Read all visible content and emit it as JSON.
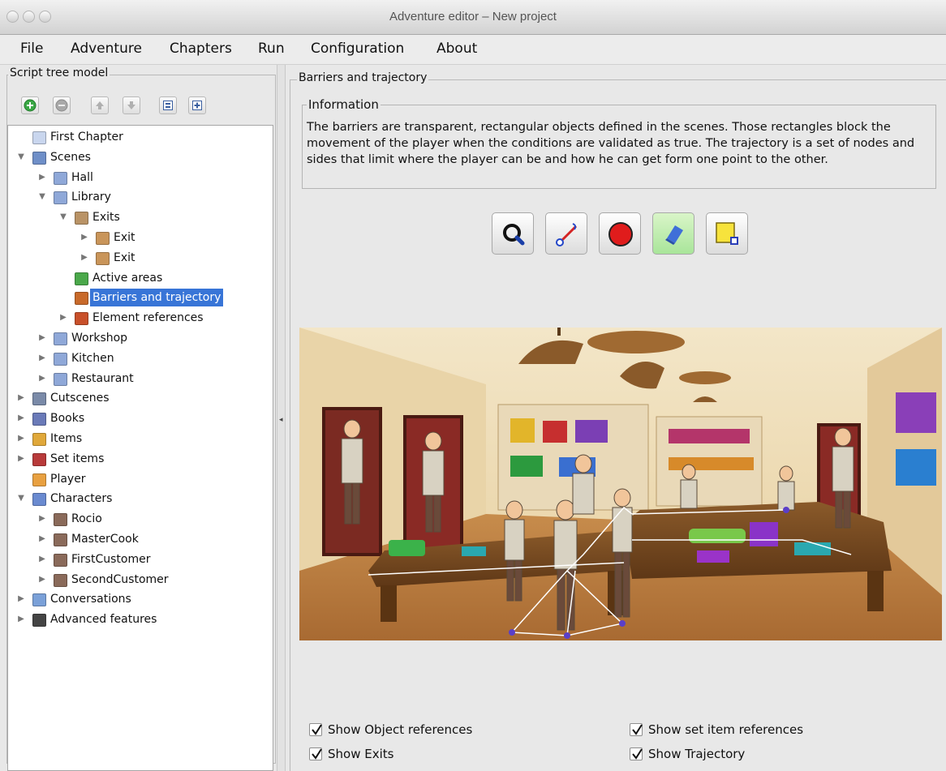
{
  "window": {
    "title": "Adventure editor – New project"
  },
  "menu": [
    "File",
    "Adventure",
    "Chapters",
    "Run",
    "Configuration",
    "About"
  ],
  "left_panel": {
    "title": "Script tree model",
    "toolbar": [
      {
        "name": "add-node-button",
        "icon": "plus-icon"
      },
      {
        "name": "remove-node-button",
        "icon": "minus-icon"
      },
      {
        "name": "move-up-button",
        "icon": "arrow-up-icon"
      },
      {
        "name": "move-down-button",
        "icon": "arrow-down-icon"
      },
      {
        "name": "collapse-all-button",
        "icon": "collapse-icon"
      },
      {
        "name": "expand-all-button",
        "icon": "expand-icon"
      }
    ],
    "tree": [
      {
        "label": "First Chapter",
        "level": 0,
        "arrow": "",
        "icon": "chapter-icon"
      },
      {
        "label": "Scenes",
        "level": 0,
        "arrow": "open",
        "icon": "scenes-folder-icon"
      },
      {
        "label": "Hall",
        "level": 1,
        "arrow": "closed",
        "icon": "scene-icon"
      },
      {
        "label": "Library",
        "level": 1,
        "arrow": "open",
        "icon": "scene-icon"
      },
      {
        "label": "Exits",
        "level": 2,
        "arrow": "open",
        "icon": "exits-folder-icon"
      },
      {
        "label": "Exit",
        "level": 3,
        "arrow": "closed",
        "icon": "door-icon"
      },
      {
        "label": "Exit",
        "level": 3,
        "arrow": "closed",
        "icon": "door-icon"
      },
      {
        "label": "Active areas",
        "level": 2,
        "arrow": "",
        "icon": "active-areas-icon"
      },
      {
        "label": "Barriers and trajectory",
        "level": 2,
        "arrow": "",
        "icon": "barriers-icon",
        "selected": true
      },
      {
        "label": "Element references",
        "level": 2,
        "arrow": "closed",
        "icon": "element-references-icon"
      },
      {
        "label": "Workshop",
        "level": 1,
        "arrow": "closed",
        "icon": "scene-icon"
      },
      {
        "label": "Kitchen",
        "level": 1,
        "arrow": "closed",
        "icon": "scene-icon"
      },
      {
        "label": "Restaurant",
        "level": 1,
        "arrow": "closed",
        "icon": "scene-icon"
      },
      {
        "label": "Cutscenes",
        "level": 0,
        "arrow": "closed",
        "icon": "cutscenes-icon"
      },
      {
        "label": "Books",
        "level": 0,
        "arrow": "closed",
        "icon": "books-icon"
      },
      {
        "label": "Items",
        "level": 0,
        "arrow": "closed",
        "icon": "items-icon"
      },
      {
        "label": "Set items",
        "level": 0,
        "arrow": "closed",
        "icon": "set-items-icon"
      },
      {
        "label": "Player",
        "level": 0,
        "arrow": "",
        "icon": "player-icon"
      },
      {
        "label": "Characters",
        "level": 0,
        "arrow": "open",
        "icon": "characters-icon"
      },
      {
        "label": "Rocio",
        "level": 1,
        "arrow": "closed",
        "icon": "character-icon"
      },
      {
        "label": "MasterCook",
        "level": 1,
        "arrow": "closed",
        "icon": "character-icon"
      },
      {
        "label": "FirstCustomer",
        "level": 1,
        "arrow": "closed",
        "icon": "character-icon"
      },
      {
        "label": "SecondCustomer",
        "level": 1,
        "arrow": "closed",
        "icon": "character-icon"
      },
      {
        "label": "Conversations",
        "level": 0,
        "arrow": "closed",
        "icon": "conversations-icon"
      },
      {
        "label": "Advanced features",
        "level": 0,
        "arrow": "closed",
        "icon": "advanced-features-icon"
      }
    ]
  },
  "right_panel": {
    "title": "Barriers and trajectory",
    "info_title": "Information",
    "info_text": "The barriers are transparent, rectangular objects defined in the scenes. Those rectangles block the movement of the player when the conditions are validated as true. The trajectory is a set of nodes and sides that limit where the player can be and how he can get form one point to the other.",
    "tools": [
      {
        "name": "zoom-tool-button",
        "icon": "magnifier-icon"
      },
      {
        "name": "edit-side-tool-button",
        "icon": "edit-side-icon"
      },
      {
        "name": "add-node-tool-button",
        "icon": "red-circle-icon"
      },
      {
        "name": "delete-tool-button",
        "icon": "eraser-icon"
      },
      {
        "name": "add-barrier-tool-button",
        "icon": "barrier-rectangle-icon"
      }
    ],
    "checkboxes": [
      {
        "label": "Show Object references",
        "checked": true
      },
      {
        "label": "Show set item references",
        "checked": true
      },
      {
        "label": "Show Exits",
        "checked": true
      },
      {
        "label": "Show Trajectory",
        "checked": true
      }
    ]
  },
  "colors": {
    "selection": "#3875d7",
    "trajectory": "#ffffff",
    "node": "#5a3fc8"
  }
}
